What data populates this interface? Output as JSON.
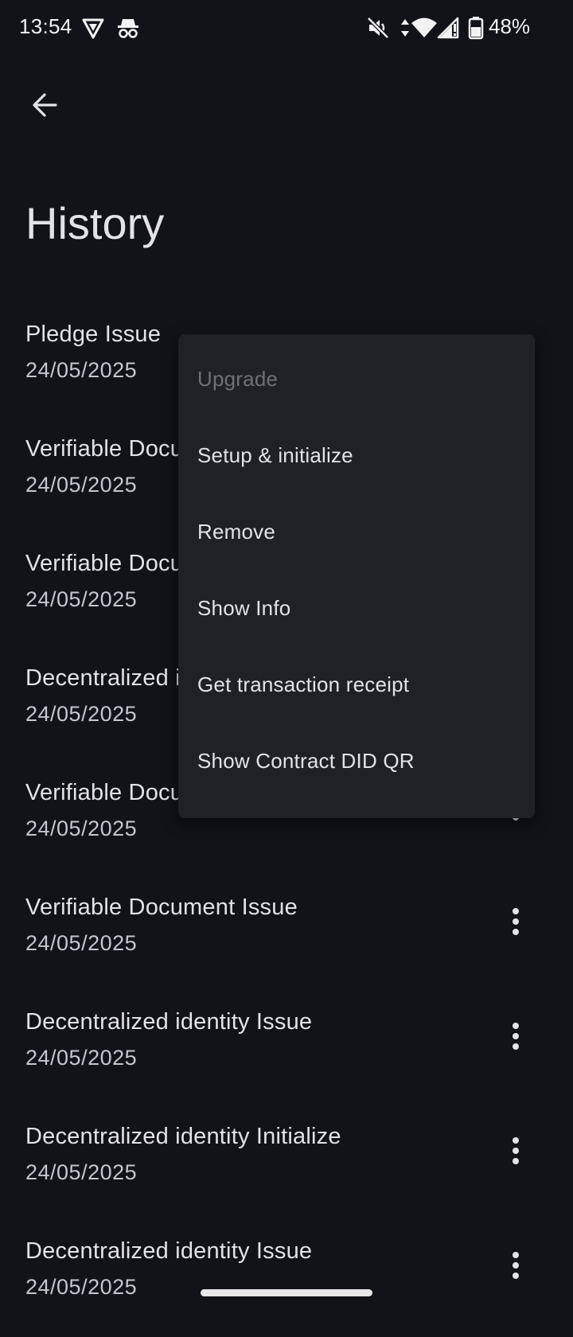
{
  "status_bar": {
    "time": "13:54",
    "battery_percent": "48%",
    "icons": [
      "vpn-shield-icon",
      "incognito-icon",
      "muted-icon",
      "data-arrows-icon",
      "wifi-icon",
      "signal-icon",
      "battery-icon"
    ]
  },
  "app_bar": {
    "back_icon": "arrow-back-icon",
    "title": "History"
  },
  "history": {
    "items": [
      {
        "title": "Pledge Issue",
        "date": "24/05/2025"
      },
      {
        "title": "Verifiable Document Issue",
        "date": "24/05/2025"
      },
      {
        "title": "Verifiable Document Issue",
        "date": "24/05/2025"
      },
      {
        "title": "Decentralized identity Issue",
        "date": "24/05/2025"
      },
      {
        "title": "Verifiable Document Issue",
        "date": "24/05/2025"
      },
      {
        "title": "Verifiable Document Issue",
        "date": "24/05/2025"
      },
      {
        "title": "Decentralized identity Issue",
        "date": "24/05/2025"
      },
      {
        "title": "Decentralized identity Initialize",
        "date": "24/05/2025"
      },
      {
        "title": "Decentralized identity Issue",
        "date": "24/05/2025"
      }
    ],
    "more_icon": "more-vert-icon"
  },
  "context_menu": {
    "items": [
      {
        "label": "Upgrade",
        "enabled": false
      },
      {
        "label": "Setup & initialize",
        "enabled": true
      },
      {
        "label": "Remove",
        "enabled": true
      },
      {
        "label": "Show Info",
        "enabled": true
      },
      {
        "label": "Get transaction receipt",
        "enabled": true
      },
      {
        "label": "Show Contract DID QR",
        "enabled": true
      }
    ]
  },
  "colors": {
    "background": "#111318",
    "menu_surface": "#1f2127",
    "text_primary": "#e3e2e6",
    "text_secondary": "#c4c6d0",
    "text_disabled": "#6e7077"
  }
}
